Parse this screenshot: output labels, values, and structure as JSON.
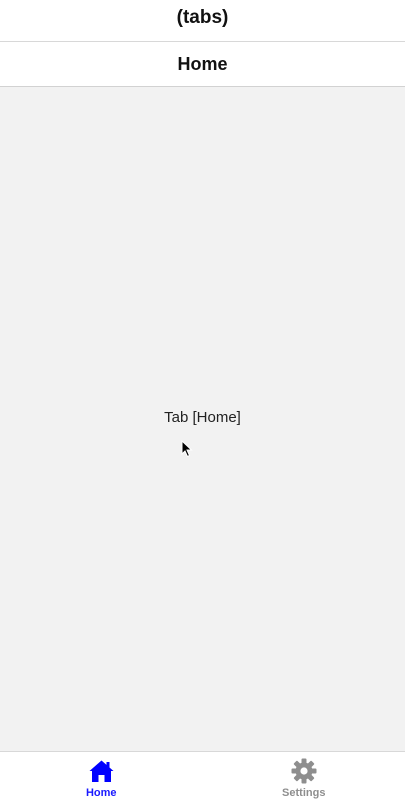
{
  "app": {
    "title": "(tabs)"
  },
  "screen": {
    "title": "Home",
    "body_text": "Tab [Home]"
  },
  "tab_bar": {
    "tabs": [
      {
        "label": "Home",
        "icon": "home-icon",
        "active": true
      },
      {
        "label": "Settings",
        "icon": "gear-icon",
        "active": false
      }
    ]
  },
  "colors": {
    "active_tint": "#0000ff",
    "inactive_tint": "#8e8e8e",
    "background": "#f2f2f2",
    "header_bg": "#ffffff"
  }
}
